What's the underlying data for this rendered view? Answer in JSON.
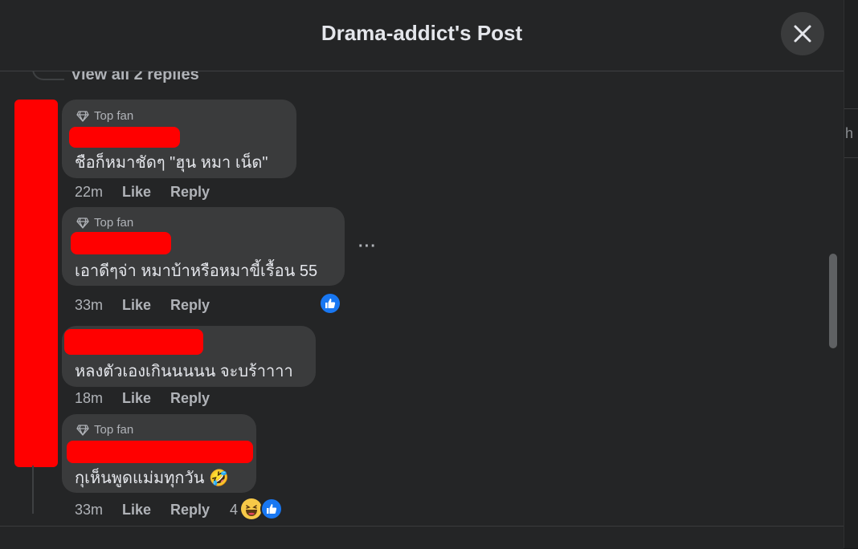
{
  "dialog": {
    "title": "Drama-addict's Post"
  },
  "thread": {
    "view_replies": "View all 2 replies"
  },
  "comments": [
    {
      "badge": "Top fan",
      "text": "ชือก็หมาชัดๆ \"ฮุน หมา เน็ด\"",
      "time": "22m",
      "like": "Like",
      "reply": "Reply"
    },
    {
      "badge": "Top fan",
      "text": "เอาดีๆจ่า หมาบ้าหรือหมาขี้เรื้อน 55",
      "time": "33m",
      "like": "Like",
      "reply": "Reply",
      "reactions": [
        "like"
      ]
    },
    {
      "text": "หลงตัวเองเกินนนนน จะบร้าาาา",
      "time": "18m",
      "like": "Like",
      "reply": "Reply"
    },
    {
      "badge": "Top fan",
      "text": "กุเห็นพูดแม่มทุกวัน 🤣",
      "time": "33m",
      "like": "Like",
      "reply": "Reply",
      "reaction_count": "4",
      "reactions": [
        "haha",
        "like"
      ]
    }
  ],
  "comment_more": "···",
  "backdrop_fragment": "h",
  "icons": {
    "close": "close-icon",
    "badge": "diamond-icon",
    "like": "thumbs-up-icon",
    "haha": "laughing-face-icon"
  },
  "colors": {
    "background": "#242526",
    "bubble": "#3a3b3c",
    "redaction": "#ff0000",
    "like_blue": "#1877f2"
  }
}
